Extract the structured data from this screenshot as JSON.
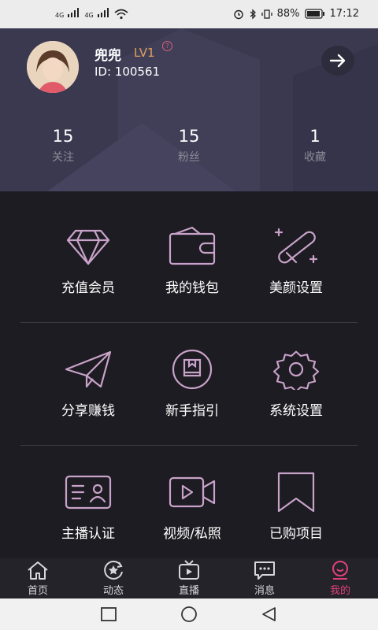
{
  "status_bar": {
    "signal1": "4G",
    "signal2": "4G",
    "battery": "88%",
    "time": "17:12"
  },
  "profile": {
    "name": "兜兜",
    "level": "LV1",
    "help": "?",
    "id": "ID: 100561"
  },
  "stats": [
    {
      "value": "15",
      "label": "关注"
    },
    {
      "value": "15",
      "label": "粉丝"
    },
    {
      "value": "1",
      "label": "收藏"
    }
  ],
  "menu": [
    {
      "label": "充值会员",
      "icon": "diamond-icon"
    },
    {
      "label": "我的钱包",
      "icon": "wallet-icon"
    },
    {
      "label": "美颜设置",
      "icon": "beauty-wand-icon"
    },
    {
      "label": "分享赚钱",
      "icon": "paper-plane-icon"
    },
    {
      "label": "新手指引",
      "icon": "guide-book-icon"
    },
    {
      "label": "系统设置",
      "icon": "gear-icon"
    },
    {
      "label": "主播认证",
      "icon": "id-card-icon"
    },
    {
      "label": "视频/私照",
      "icon": "video-camera-icon"
    },
    {
      "label": "已购项目",
      "icon": "bookmark-icon"
    }
  ],
  "tabs": [
    {
      "label": "首页",
      "icon": "home-icon"
    },
    {
      "label": "动态",
      "icon": "star-refresh-icon"
    },
    {
      "label": "直播",
      "icon": "tv-icon"
    },
    {
      "label": "消息",
      "icon": "chat-bubble-icon"
    },
    {
      "label": "我的",
      "icon": "profile-icon",
      "active": true
    }
  ],
  "colors": {
    "accent": "#e0407a",
    "icon_stroke": "#c9a2c9",
    "header_bg": "#3a3950",
    "level": "#e0a05c"
  }
}
